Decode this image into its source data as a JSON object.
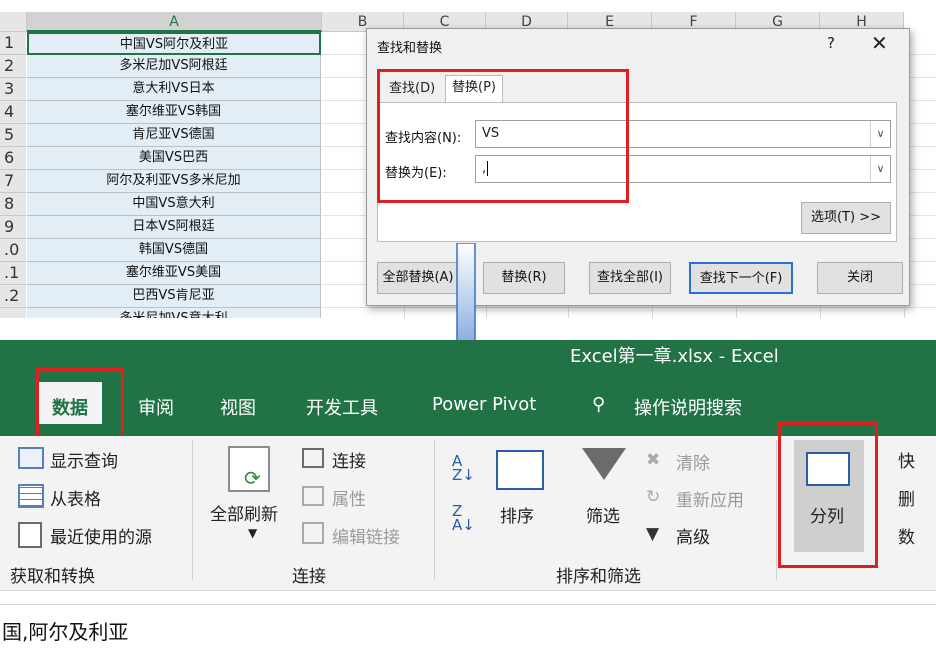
{
  "sheet": {
    "columns": [
      "A",
      "B",
      "C",
      "D",
      "E",
      "F",
      "G",
      "H"
    ],
    "rows": [
      {
        "num": "1",
        "value": "中国VS阿尔及利亚"
      },
      {
        "num": "2",
        "value": "多米尼加VS阿根廷"
      },
      {
        "num": "3",
        "value": "意大利VS日本"
      },
      {
        "num": "4",
        "value": "塞尔维亚VS韩国"
      },
      {
        "num": "5",
        "value": "肯尼亚VS德国"
      },
      {
        "num": "6",
        "value": "美国VS巴西"
      },
      {
        "num": "7",
        "value": "阿尔及利亚VS多米尼加"
      },
      {
        "num": "8",
        "value": "中国VS意大利"
      },
      {
        "num": "9",
        "value": "日本VS阿根廷"
      },
      {
        "num": ".0",
        "value": "韩国VS德国"
      },
      {
        "num": ".1",
        "value": "塞尔维亚VS美国"
      },
      {
        "num": ".2",
        "value": "巴西VS肯尼亚"
      },
      {
        "num": "",
        "value": "多米尼加VS意大利"
      }
    ]
  },
  "dialog": {
    "title": "查找和替换",
    "help": "?",
    "close": "✕",
    "tab_find": "查找(D)",
    "tab_replace": "替换(P)",
    "find_label": "查找内容(N):",
    "find_value": "VS",
    "replace_label": "替换为(E):",
    "replace_value": ",",
    "options_btn": "选项(T) >>",
    "replace_all_btn": "全部替换(A)",
    "replace_btn": "替换(R)",
    "find_all_btn": "查找全部(I)",
    "find_next_btn": "查找下一个(F)",
    "close_btn": "关闭"
  },
  "excel": {
    "title": "Excel第一章.xlsx  -  Excel",
    "tabs": [
      "数据",
      "审阅",
      "视图",
      "开发工具",
      "Power Pivot",
      "操作说明搜索"
    ],
    "get_transform": {
      "items": [
        "显示查询",
        "从表格",
        "最近使用的源"
      ],
      "group": "获取和转换"
    },
    "connections": {
      "refresh_all": "全部刷新",
      "items": [
        "连接",
        "属性",
        "编辑链接"
      ],
      "group": "连接"
    },
    "sort_filter": {
      "sort": "排序",
      "filter": "筛选",
      "clear": "清除",
      "reapply": "重新应用",
      "advanced": "高级",
      "group": "排序和筛选"
    },
    "data_tools": {
      "text_to_columns": "分列",
      "extra": [
        "快",
        "删",
        "数"
      ]
    },
    "formula_text": "国,阿尔及利亚"
  },
  "colors": {
    "excel_green": "#217346",
    "highlight_red": "#e02020",
    "selection_fill": "#e3edf6"
  }
}
